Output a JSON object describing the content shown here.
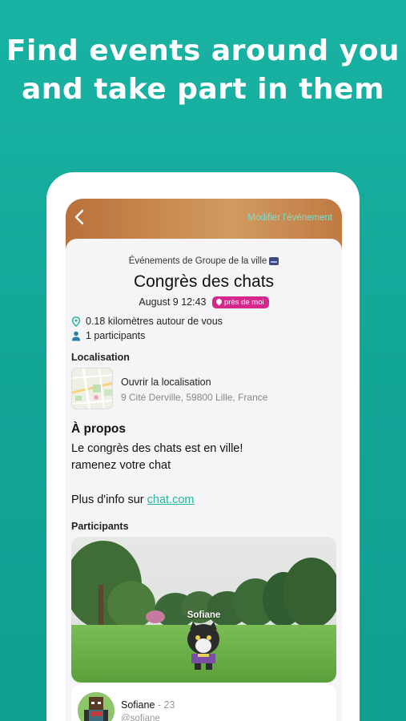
{
  "headline": "Find events around you and take part in them",
  "header": {
    "back_icon": "chevron-left-icon",
    "edit_label": "Modifier l'événement"
  },
  "event": {
    "group_line": "Événements de Groupe de la ville",
    "title": "Congrès des chats",
    "datetime": "August 9 12:43",
    "near_badge": "près de moi",
    "distance": "0.18 kilomètres autour de vous",
    "participants_count": "1 participants"
  },
  "location": {
    "section_label": "Localisation",
    "open_label": "Ouvrir la localisation",
    "address": "9 Cité Derville, 59800 Lille, France"
  },
  "about": {
    "section_label": "À propos",
    "text_line1": "Le congrès des chats est en ville!",
    "text_line2": "ramenez votre chat",
    "more_prefix": "Plus d'info sur ",
    "more_link": "chat.com"
  },
  "participants": {
    "section_label": "Participants",
    "scene_avatar_name": "Sofiane",
    "list": [
      {
        "name": "Sofiane",
        "age": "- 23",
        "handle": "@sofiane"
      }
    ]
  },
  "colors": {
    "background": "#14a898",
    "accent": "#26b7a0",
    "badge": "#d6278d"
  }
}
